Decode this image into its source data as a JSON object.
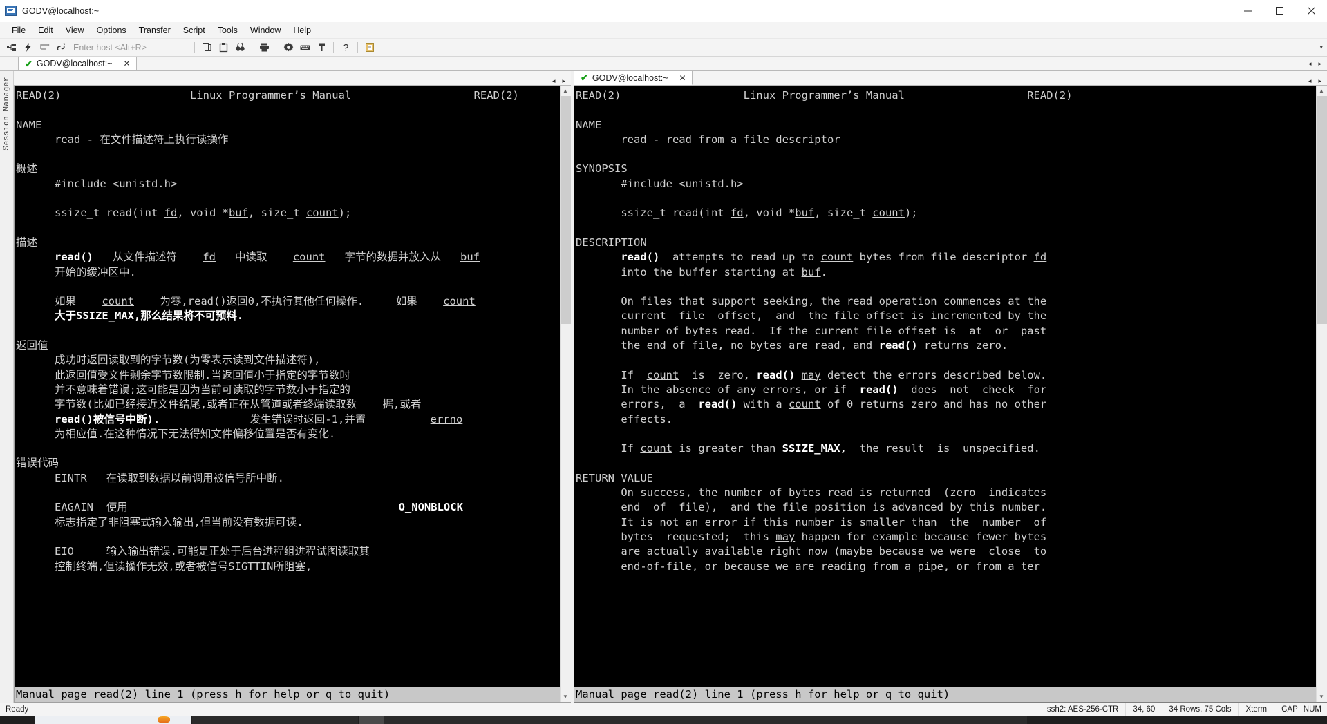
{
  "window": {
    "title": "GODV@localhost:~",
    "icon": "terminal-app-icon",
    "buttons": {
      "minimize": "─",
      "maximize": "☐",
      "close": "✕"
    }
  },
  "menubar": {
    "items": [
      "File",
      "Edit",
      "View",
      "Options",
      "Transfer",
      "Script",
      "Tools",
      "Window",
      "Help"
    ]
  },
  "toolbar": {
    "host_placeholder": "Enter host <Alt+R>",
    "icons": [
      "connect-icon",
      "quick-connect-icon",
      "reconnect-icon",
      "disconnect-icon",
      "copy-icon",
      "paste-icon",
      "find-icon",
      "print-icon",
      "settings-icon",
      "keymap-icon",
      "key-icon",
      "help-icon",
      "log-icon"
    ],
    "overflow": "▾"
  },
  "sidebar": {
    "label": "Session Manager"
  },
  "tabs": {
    "left": {
      "label": "GODV@localhost:~",
      "status": "connected",
      "close": "✕"
    },
    "right": {
      "label": "GODV@localhost:~",
      "status": "connected",
      "close": "✕"
    },
    "nav_prev": "◂",
    "nav_next": "▸"
  },
  "terminal_left": {
    "status_line": "Manual page read(2) line 1 (press h for help or q to quit)",
    "lines": [
      "READ(2)                    Linux Programmer’s Manual                   READ(2)",
      "",
      "NAME",
      "      read - 在文件描述符上执行读操作",
      "",
      "概述",
      "      #include <unistd.h>",
      "",
      "      ssize_t read(int fd, void *buf, size_t count);",
      "",
      "描述",
      "      read()   从文件描述符    fd   中读取    count   字节的数据并放入从   buf",
      "      开始的缓冲区中.",
      "",
      "      如果    count    为零,read()返回0,不执行其他任何操作.     如果    count",
      "      大于SSIZE_MAX,那么结果将不可预料.",
      "",
      "返回值",
      "      成功时返回读取到的字节数(为零表示读到文件描述符),",
      "      此返回值受文件剩余字节数限制.当返回值小于指定的字节数时",
      "      并不意味着错误;这可能是因为当前可读取的字节数小于指定的",
      "      字节数(比如已经接近文件结尾,或者正在从管道或者终端读取数    据,或者",
      "      read()被信号中断).              发生错误时返回-1,并置          errno",
      "      为相应值.在这种情况下无法得知文件偏移位置是否有变化.",
      "",
      "错误代码",
      "      EINTR   在读取到数据以前调用被信号所中断.",
      "",
      "      EAGAIN  使用                                          O_NONBLOCK",
      "      标志指定了非阻塞式输入输出,但当前没有数据可读.",
      "",
      "      EIO     输入输出错误.可能是正处于后台进程组进程试图读取其",
      "      控制终端,但读操作无效,或者被信号SIGTTIN所阻塞,"
    ]
  },
  "terminal_right": {
    "status_line": "Manual page read(2) line 1 (press h for help or q to quit)",
    "lines": [
      "READ(2)                   Linux Programmer’s Manual                   READ(2)",
      "",
      "NAME",
      "       read - read from a file descriptor",
      "",
      "SYNOPSIS",
      "       #include <unistd.h>",
      "",
      "       ssize_t read(int fd, void *buf, size_t count);",
      "",
      "DESCRIPTION",
      "       read()  attempts to read up to count bytes from file descriptor fd",
      "       into the buffer starting at buf.",
      "",
      "       On files that support seeking, the read operation commences at the",
      "       current  file  offset,  and  the file offset is incremented by the",
      "       number of bytes read.  If the current file offset is  at  or  past",
      "       the end of file, no bytes are read, and read() returns zero.",
      "",
      "       If  count  is  zero, read() may detect the errors described below.",
      "       In the absence of any errors, or if  read()  does  not  check  for",
      "       errors,  a  read() with a count of 0 returns zero and has no other",
      "       effects.",
      "",
      "       If count is greater than SSIZE_MAX,  the result  is  unspecified.",
      "",
      "RETURN VALUE",
      "       On success, the number of bytes read is returned  (zero  indicates",
      "       end  of  file),  and the file position is advanced by this number.",
      "       It is not an error if this number is smaller than  the  number  of",
      "       bytes  requested;  this may happen for example because fewer bytes",
      "       are actually available right now (maybe because we were  close  to",
      "       end-of-file, or because we are reading from a pipe, or from a ter"
    ]
  },
  "statusbar": {
    "ready": "Ready",
    "cipher": "ssh2: AES-256-CTR",
    "cursor": "34, 60",
    "dimensions": "34 Rows, 75 Cols",
    "emulation": "Xterm",
    "caps": "CAP",
    "num": "NUM"
  }
}
